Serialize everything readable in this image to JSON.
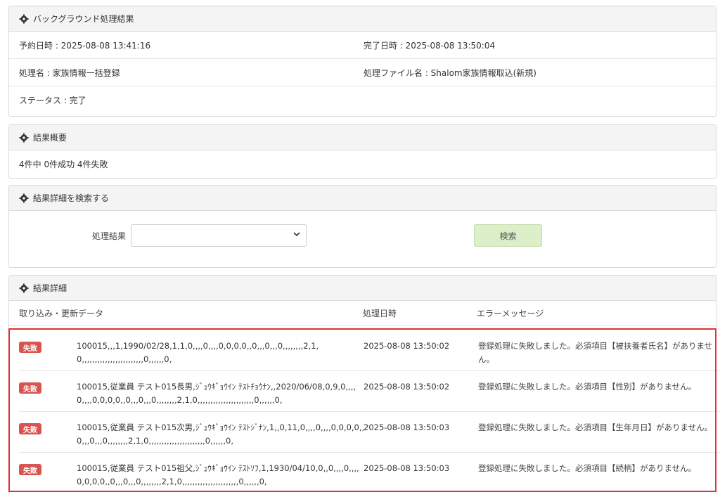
{
  "bg_panel": {
    "title": "バックグラウンド処理結果",
    "scheduled": "予約日時 : 2025-08-08 13:41:16",
    "completed": "完了日時 : 2025-08-08 13:50:04",
    "process_name": "処理名 : 家族情報一括登録",
    "process_file": "処理ファイル名 : Shalom家族情報取込(新規)",
    "status": "ステータス : 完了"
  },
  "summary_panel": {
    "title": "結果概要",
    "text": "4件中 0件成功 4件失敗"
  },
  "search_panel": {
    "title": "結果詳細を検索する",
    "label": "処理結果",
    "selected": "",
    "button": "検索"
  },
  "detail_panel": {
    "title": "結果詳細",
    "headers": [
      "取り込み・更新データ",
      "処理日時",
      "エラーメッセージ"
    ],
    "rows": [
      {
        "badge": "失敗",
        "data": "100015,,,1,1990/02/28,1,1,0,,,,0,,,,0,0,0,0,,0,,,0,,,0,,,,,,,,2,1,0,,,,,,,,,,,,,,,,,,,,,,,,0,,,,,,0,",
        "date": "2025-08-08 13:50:02",
        "error": "登録処理に失敗しました。必須項目【被扶養者氏名】がありません。"
      },
      {
        "badge": "失敗",
        "data": "100015,従業員 テスト015長男,ｼﾞｭｳｷﾞｮｳｲﾝ ﾃｽﾄﾁｮｳﾅﾝ,,2020/06/08,0,9,0,,,,0,,,,0,0,0,0,,0,,,0,,,0,,,,,,,,2,1,0,,,,,,,,,,,,,,,,,,,,,,0,,,,,,0,",
        "date": "2025-08-08 13:50:02",
        "error": "登録処理に失敗しました。必須項目【性別】がありません。"
      },
      {
        "badge": "失敗",
        "data": "100015,従業員 テスト015次男,ｼﾞｭｳｷﾞｮｳｲﾝ ﾃｽﾄｼﾞﾅﾝ,1,,0,11,0,,,,0,,,,0,0,0,0,,0,,,0,,,0,,,,,,,,2,1,0,,,,,,,,,,,,,,,,,,,,,,0,,,,,,0,",
        "date": "2025-08-08 13:50:03",
        "error": "登録処理に失敗しました。必須項目【生年月日】がありません。"
      },
      {
        "badge": "失敗",
        "data": "100015,従業員 テスト015祖父,ｼﾞｭｳｷﾞｮｳｲﾝ ﾃｽﾄｿﾌ,1,1930/04/10,0,,0,,,,0,,,,0,0,0,0,,0,,,0,,,0,,,,,,,,2,1,0,,,,,,,,,,,,,,,,,,,,,,0,,,,,,0,",
        "date": "2025-08-08 13:50:03",
        "error": "登録処理に失敗しました。必須項目【続柄】がありません。"
      }
    ]
  },
  "colors": {
    "fail_badge": "#d9534f",
    "highlight_border": "#e03030",
    "search_button": "#dcefc8"
  },
  "icons": [
    "gear-icon",
    "chevron-down-icon"
  ]
}
